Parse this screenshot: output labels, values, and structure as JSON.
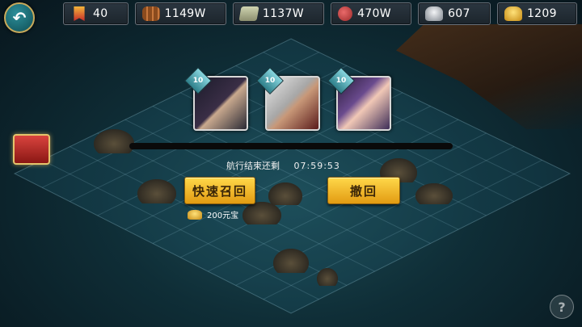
{
  "topbar": {
    "resources": [
      {
        "icon": "banner-icon",
        "value": "40"
      },
      {
        "icon": "wood-icon",
        "value": "1149W"
      },
      {
        "icon": "stone-icon",
        "value": "1137W"
      },
      {
        "icon": "meat-icon",
        "value": "470W"
      },
      {
        "icon": "silver-icon",
        "value": "607"
      },
      {
        "icon": "gold-ingot-icon",
        "value": "1209"
      }
    ]
  },
  "heroes": [
    {
      "level": "10"
    },
    {
      "level": "10"
    },
    {
      "level": "10"
    }
  ],
  "voyage": {
    "label": "航行结束还剩",
    "timer": "07:59:53",
    "progress": 0.0
  },
  "actions": {
    "quick_recall": "快速召回",
    "withdraw": "撤回",
    "cost": "200元宝"
  },
  "help_icon": "?",
  "colors": {
    "button_gold": "#f5c22c",
    "sea_teal": "#1d4b55"
  }
}
